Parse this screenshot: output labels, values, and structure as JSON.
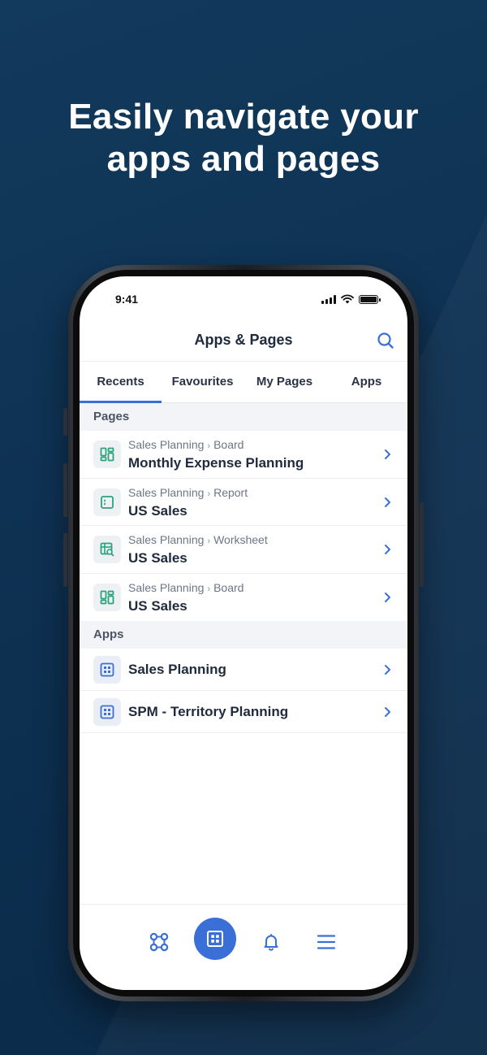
{
  "headline": {
    "line1": "Easily navigate your",
    "line2": "apps and pages"
  },
  "status_bar": {
    "time": "9:41"
  },
  "header": {
    "title": "Apps & Pages"
  },
  "tabs": [
    {
      "label": "Recents",
      "active": true
    },
    {
      "label": "Favourites",
      "active": false
    },
    {
      "label": "My Pages",
      "active": false
    },
    {
      "label": "Apps",
      "active": false
    }
  ],
  "sections": {
    "pages": {
      "title": "Pages",
      "items": [
        {
          "parent": "Sales Planning",
          "type": "Board",
          "title": "Monthly Expense Planning",
          "icon": "board-icon"
        },
        {
          "parent": "Sales Planning",
          "type": "Report",
          "title": "US Sales",
          "icon": "report-icon"
        },
        {
          "parent": "Sales Planning",
          "type": "Worksheet",
          "title": "US Sales",
          "icon": "worksheet-icon"
        },
        {
          "parent": "Sales Planning",
          "type": "Board",
          "title": "US Sales",
          "icon": "board-icon"
        }
      ]
    },
    "apps": {
      "title": "Apps",
      "items": [
        {
          "title": "Sales Planning",
          "icon": "app-grid-icon"
        },
        {
          "title": "SPM - Territory Planning",
          "icon": "app-grid-icon"
        }
      ]
    }
  },
  "bottom_nav": [
    {
      "name": "workflow-icon",
      "active": false
    },
    {
      "name": "apps-icon",
      "active": true
    },
    {
      "name": "bell-icon",
      "active": false
    },
    {
      "name": "menu-icon",
      "active": false
    }
  ],
  "colors": {
    "accent": "#3a6fd8",
    "page_icon": "#2aa37a",
    "background": "#0e3152"
  }
}
